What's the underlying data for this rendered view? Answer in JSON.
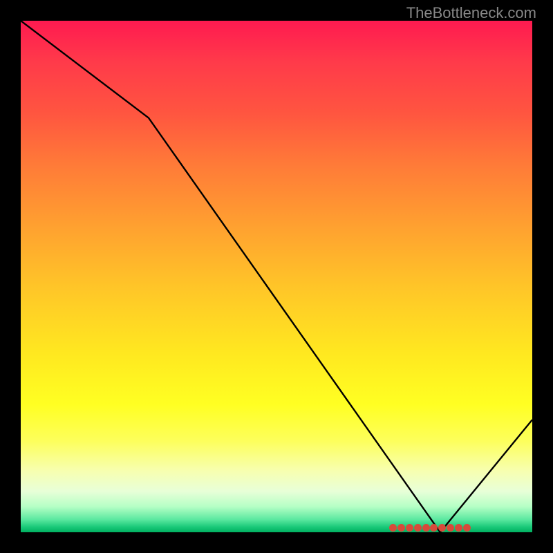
{
  "watermark": "TheBottleneck.com",
  "chart_data": {
    "type": "line",
    "title": "",
    "xlabel": "",
    "ylabel": "",
    "xlim": [
      0,
      100
    ],
    "ylim": [
      0,
      100
    ],
    "x": [
      0,
      25,
      82,
      100
    ],
    "values": [
      100,
      81,
      0,
      22
    ],
    "optimal_band_x": [
      72,
      88
    ],
    "background": "rainbow-gradient-vertical",
    "annotations": []
  }
}
